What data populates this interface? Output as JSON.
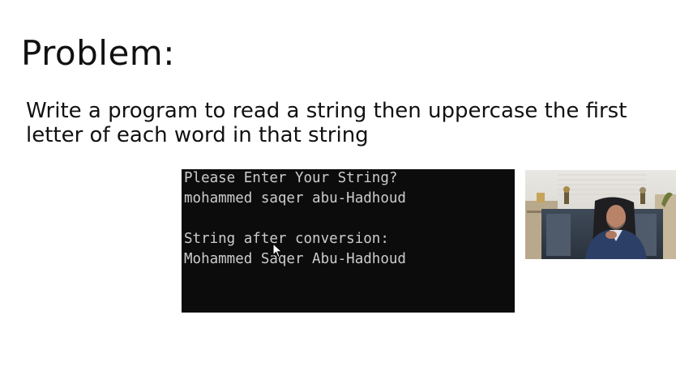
{
  "slide": {
    "title": "Problem:",
    "problem_lines": [
      "Write a program to read a string then uppercase the first",
      "letter of each word in that string"
    ]
  },
  "console": {
    "lines": [
      "Please Enter Your String?",
      "mohammed saqer abu-Hadhoud",
      "",
      "String after conversion:",
      "Mohammed Saqer Abu-Hadhoud"
    ],
    "background": "#0c0c0c",
    "text_color": "#cccccc"
  },
  "webcam": {
    "icon": "presenter-video"
  }
}
